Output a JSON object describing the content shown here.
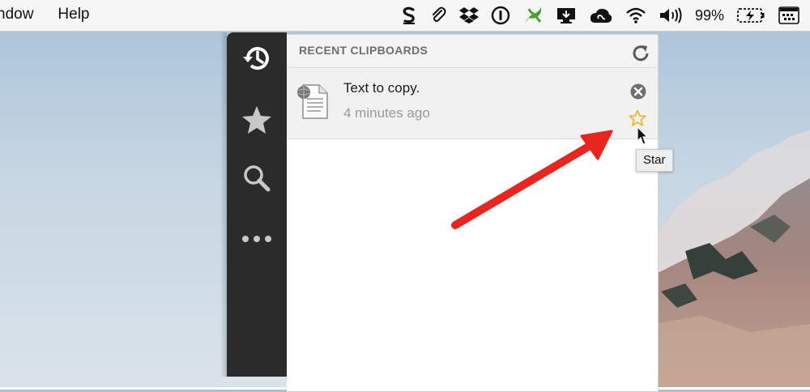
{
  "menubar": {
    "menus": [
      "ndow",
      "Help"
    ],
    "battery_percent": "99%",
    "status_icons": [
      "scrivener-s-icon",
      "paperclip-icon",
      "dropbox-icon",
      "1password-icon",
      "leaf-app-icon",
      "display-icon",
      "creative-cloud-icon",
      "wifi-icon",
      "volume-icon",
      "battery-charging-icon",
      "keyboard-viewer-icon"
    ]
  },
  "sidebar": {
    "items": [
      "history-icon",
      "star-icon",
      "search-icon",
      "more-icon"
    ]
  },
  "panel": {
    "title": "RECENT CLIPBOARDS",
    "items": [
      {
        "text": "Text to copy.",
        "time": "4 minutes ago"
      }
    ]
  },
  "tooltip": {
    "text": "Star"
  },
  "colors": {
    "arrow": "#e8251f",
    "star": "#f2b322",
    "sidebar": "#2b2b2b"
  }
}
